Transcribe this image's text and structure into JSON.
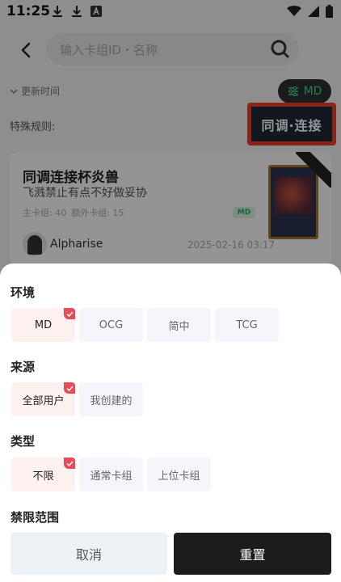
{
  "status_bar": {
    "time": "11:25",
    "notification_icons": [
      "download-icon",
      "download-icon",
      "app-a-icon"
    ],
    "system_icons": [
      "wifi-icon",
      "signal-icon",
      "battery-icon"
    ]
  },
  "search": {
    "placeholder": "输入卡组ID・名称"
  },
  "sort": {
    "label": "更新时间"
  },
  "env_pill": {
    "label": "MD",
    "accent": "#3fd58a"
  },
  "special_rules": {
    "label": "特殊规则:",
    "tag": "同调·连接",
    "highlight_color": "#e8402a"
  },
  "deck_card": {
    "title": "同调连接杯炎兽",
    "description": "飞溅禁止有点不好做妥协",
    "main_deck": "主卡组: 40",
    "extra_deck": "额外卡组: 15",
    "badge": "MD",
    "author": "Alpharise",
    "date": "2025-02-16 03:17"
  },
  "filter_sheet": {
    "environment": {
      "title": "环境",
      "options": [
        {
          "label": "MD",
          "selected": true
        },
        {
          "label": "OCG",
          "selected": false
        },
        {
          "label": "简中",
          "selected": false
        },
        {
          "label": "TCG",
          "selected": false
        }
      ]
    },
    "source": {
      "title": "来源",
      "options": [
        {
          "label": "全部用户",
          "selected": true
        },
        {
          "label": "我创建的",
          "selected": false
        }
      ]
    },
    "type": {
      "title": "类型",
      "options": [
        {
          "label": "不限",
          "selected": true
        },
        {
          "label": "通常卡组",
          "selected": false
        },
        {
          "label": "上位卡组",
          "selected": false
        }
      ]
    },
    "ban_range": {
      "title": "禁限范围"
    },
    "cancel_label": "取消",
    "reset_label": "重置",
    "check_color": "#e84b5a"
  }
}
